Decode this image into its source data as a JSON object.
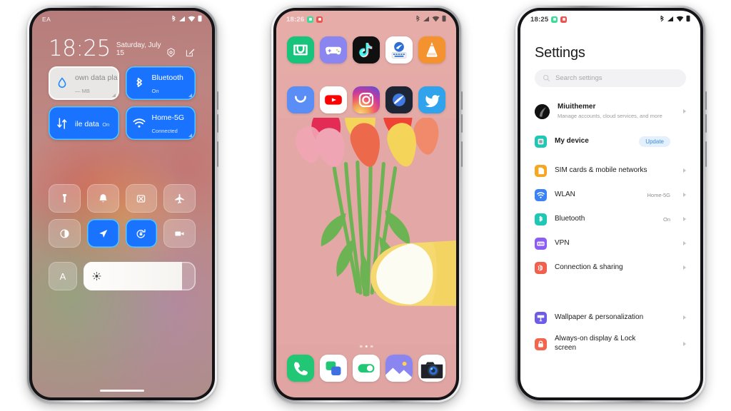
{
  "phones": {
    "left": {
      "name": "control-center",
      "statusbar": {
        "carrier": "EA",
        "icons": [
          "bluetooth-icon",
          "signal-icon",
          "wifi-icon",
          "battery-icon"
        ]
      },
      "clock": "18:25",
      "date": "Saturday, July 15",
      "header_icons": [
        "settings-gear-icon",
        "edit-icon"
      ],
      "tiles": [
        {
          "title": "own data pla",
          "subtitle": "— MB",
          "state": "off",
          "icon": "data-usage-drop-icon"
        },
        {
          "title": "Bluetooth",
          "subtitle": "On",
          "state": "on",
          "icon": "bluetooth-icon"
        },
        {
          "title": "ile data",
          "subtitle": "On",
          "state": "on",
          "icon": "mobile-data-icon"
        },
        {
          "title": "Home-5G",
          "subtitle": "Connected",
          "state": "on",
          "icon": "wifi-icon"
        }
      ],
      "toggles": [
        {
          "name": "flashlight",
          "state": "off"
        },
        {
          "name": "silent-bell",
          "state": "off"
        },
        {
          "name": "screenshot",
          "state": "off"
        },
        {
          "name": "airplane-mode",
          "state": "off"
        },
        {
          "name": "dark-mode",
          "state": "off"
        },
        {
          "name": "location",
          "state": "on"
        },
        {
          "name": "auto-rotate-lock",
          "state": "on"
        },
        {
          "name": "screen-recorder",
          "state": "off"
        }
      ],
      "brightness": {
        "auto_label": "A",
        "value_percent": 88
      }
    },
    "mid": {
      "name": "home-screen",
      "statusbar": {
        "time": "18:26",
        "badges": [
          "#3ddc97",
          "#ef5350"
        ],
        "icons": [
          "bluetooth-icon",
          "signal-icon",
          "wifi-icon",
          "battery-icon"
        ]
      },
      "apps_row1": [
        "mi-home-icon",
        "game-center-icon",
        "tiktok-icon",
        "swiftkey-keyboard-icon",
        "vlc-media-player-icon"
      ],
      "apps_row2": [
        "app-store-icon",
        "youtube-icon",
        "instagram-icon",
        "samsung-internet-icon",
        "twitter-icon"
      ],
      "dock": [
        "phone-icon",
        "messages-icon",
        "settings-toggle-icon",
        "gallery-icon",
        "camera-icon"
      ],
      "wallpaper": "tulip-bouquet-illustration",
      "page_dots": 3,
      "active_dot": 2
    },
    "right": {
      "name": "settings-screen",
      "statusbar": {
        "time": "18:25",
        "badges": [
          "#3ddc97",
          "#ef5350"
        ],
        "icons": [
          "bluetooth-icon",
          "signal-icon",
          "wifi-icon",
          "battery-icon"
        ]
      },
      "title": "Settings",
      "search_placeholder": "Search settings",
      "account": {
        "name": "Miuithemer",
        "subtitle": "Manage accounts, cloud services, and more"
      },
      "device": {
        "label": "My device",
        "badge": "Update"
      },
      "groups": [
        [
          {
            "label": "SIM cards & mobile networks",
            "value": "",
            "icon": "sim-card-icon",
            "color": "#f5a623"
          },
          {
            "label": "WLAN",
            "value": "Home-5G",
            "icon": "wifi-icon",
            "color": "#3b82f6"
          },
          {
            "label": "Bluetooth",
            "value": "On",
            "icon": "bluetooth-icon",
            "color": "#1fc8b4"
          },
          {
            "label": "VPN",
            "value": "",
            "icon": "vpn-icon",
            "color": "#8b5cf6"
          },
          {
            "label": "Connection & sharing",
            "value": "",
            "icon": "connection-sharing-icon",
            "color": "#f0604d"
          }
        ],
        [
          {
            "label": "Wallpaper & personalization",
            "value": "",
            "icon": "wallpaper-icon",
            "color": "#6c5ce7"
          },
          {
            "label": "Always-on display & Lock screen",
            "value": "",
            "icon": "lock-screen-icon",
            "color": "#f4654e"
          }
        ]
      ]
    }
  },
  "colors": {
    "accent_blue": "#1a73ff",
    "accent_cyan": "#55c9ff",
    "home_bg": "#e3a8a5",
    "settings_bg": "#ffffff"
  }
}
